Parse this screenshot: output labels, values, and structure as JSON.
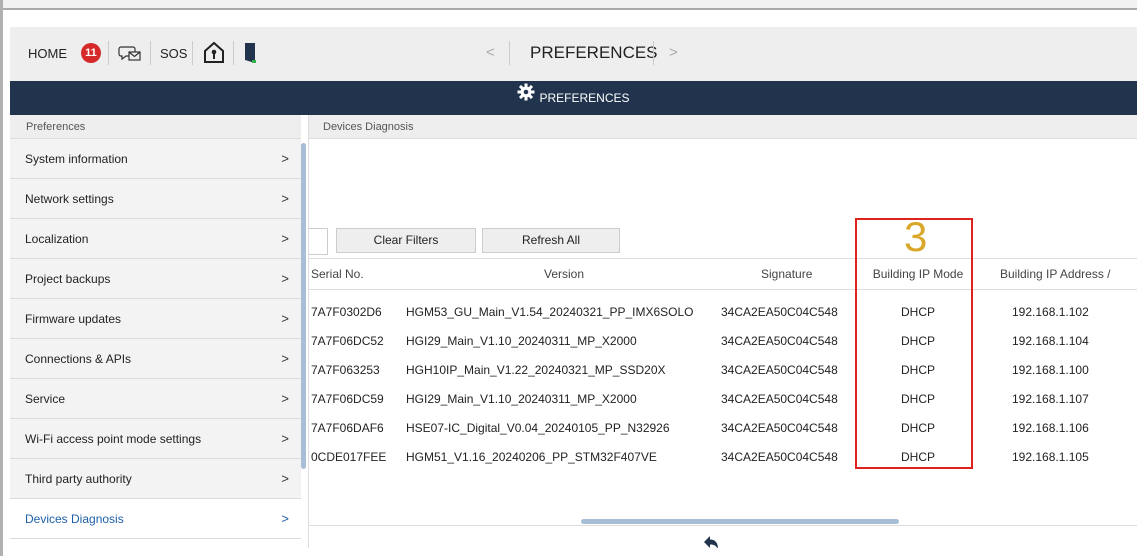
{
  "topbar": {
    "home_label": "HOME",
    "notification_count": "11",
    "sos_label": "SOS",
    "nav_title": "PREFERENCES",
    "prev_arrow": "<",
    "next_arrow": ">"
  },
  "header": {
    "title": "PREFERENCES"
  },
  "sidebar": {
    "heading": "Preferences",
    "items": [
      {
        "label": "System information"
      },
      {
        "label": "Network settings"
      },
      {
        "label": "Localization"
      },
      {
        "label": "Project backups"
      },
      {
        "label": "Firmware updates"
      },
      {
        "label": "Connections & APIs"
      },
      {
        "label": "Service"
      },
      {
        "label": "Wi-Fi access point mode settings"
      },
      {
        "label": "Third party authority"
      },
      {
        "label": "Devices Diagnosis",
        "active": true
      }
    ],
    "chevron": ">"
  },
  "main": {
    "heading": "Devices Diagnosis",
    "clear_filters": "Clear Filters",
    "refresh_all": "Refresh All",
    "annotation_number": "3",
    "columns": [
      "Serial No.",
      "Version",
      "Signature",
      "Building IP Mode",
      "Building IP Address /"
    ],
    "rows": [
      [
        "7A7F0302D6",
        "HGM53_GU_Main_V1.54_20240321_PP_IMX6SOLO",
        "34CA2EA50C04C548",
        "DHCP",
        "192.168.1.102"
      ],
      [
        "7A7F06DC52",
        "HGI29_Main_V1.10_20240311_MP_X2000",
        "34CA2EA50C04C548",
        "DHCP",
        "192.168.1.104"
      ],
      [
        "7A7F063253",
        "HGH10IP_Main_V1.22_20240321_MP_SSD20X",
        "34CA2EA50C04C548",
        "DHCP",
        "192.168.1.100"
      ],
      [
        "7A7F06DC59",
        "HGI29_Main_V1.10_20240311_MP_X2000",
        "34CA2EA50C04C548",
        "DHCP",
        "192.168.1.107"
      ],
      [
        "7A7F06DAF6",
        "HSE07-IC_Digital_V0.04_20240105_PP_N32926",
        "34CA2EA50C04C548",
        "DHCP",
        "192.168.1.106"
      ],
      [
        "0CDE017FEE",
        "HGM51_V1.16_20240206_PP_STM32F407VE",
        "34CA2EA50C04C548",
        "DHCP",
        "192.168.1.105"
      ]
    ]
  },
  "colors": {
    "header_bg": "#22334d",
    "badge": "#d62a2a",
    "highlight_box": "#e0221f",
    "annotation": "#d9a82b",
    "active_item": "#1e5fa8",
    "scrollbar": "#a8bdd6"
  }
}
